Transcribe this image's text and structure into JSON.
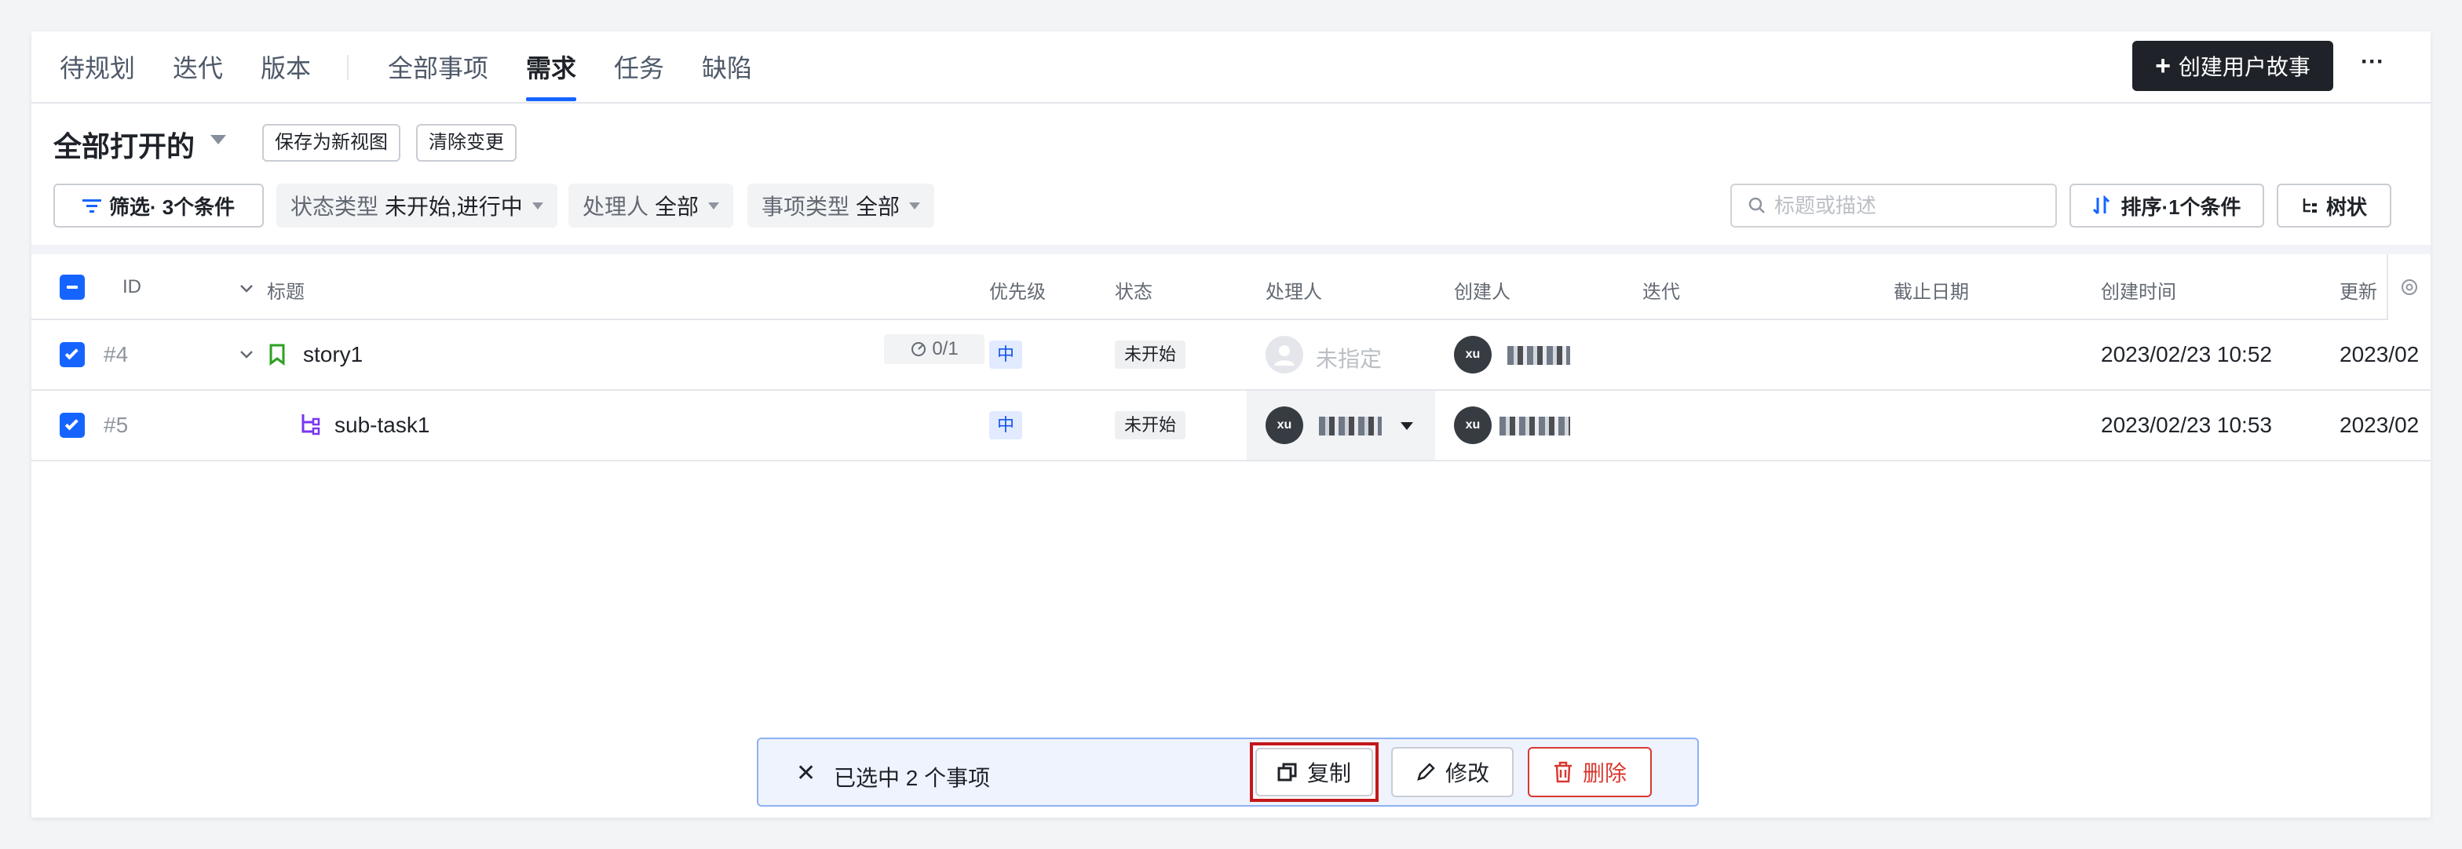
{
  "tabs": {
    "backlog": "待规划",
    "iteration": "迭代",
    "version": "版本",
    "all_items": "全部事项",
    "requirements": "需求",
    "tasks": "任务",
    "defects": "缺陷"
  },
  "header": {
    "create_button": "创建用户故事",
    "create_icon": "+",
    "more_icon": "···"
  },
  "view": {
    "title": "全部打开的",
    "save_as_new_view": "保存为新视图",
    "clear_changes": "清除变更"
  },
  "filters": {
    "filter_button": "筛选· 3个条件",
    "chips": [
      {
        "key": "状态类型",
        "value": "未开始,进行中"
      },
      {
        "key": "处理人",
        "value": "全部"
      },
      {
        "key": "事项类型",
        "value": "全部"
      }
    ],
    "search_placeholder": "标题或描述",
    "sort_button": "排序·1个条件",
    "tree_button": "树状"
  },
  "table": {
    "columns": {
      "id": "ID",
      "title": "标题",
      "priority": "优先级",
      "status": "状态",
      "assignee": "处理人",
      "creator": "创建人",
      "iteration": "迭代",
      "due_date": "截止日期",
      "created_at": "创建时间",
      "updated_at": "更新"
    },
    "rows": [
      {
        "id": "#4",
        "title": "story1",
        "subtask_progress": "0/1",
        "priority": "中",
        "status": "未开始",
        "assignee": "未指定",
        "creator_avatar": "xu",
        "created_at": "2023/02/23 10:52",
        "updated_at": "2023/02"
      },
      {
        "id": "#5",
        "title": "sub-task1",
        "priority": "中",
        "status": "未开始",
        "assignee_avatar": "xu",
        "creator_avatar": "xu",
        "created_at": "2023/02/23 10:53",
        "updated_at": "2023/02"
      }
    ]
  },
  "selection_bar": {
    "close_icon": "✕",
    "selected_text": "已选中 2 个事项",
    "copy": "复制",
    "edit": "修改",
    "delete": "删除"
  },
  "colors": {
    "accent": "#1664ff",
    "danger": "#d83931",
    "dark_button": "#1f2329"
  }
}
